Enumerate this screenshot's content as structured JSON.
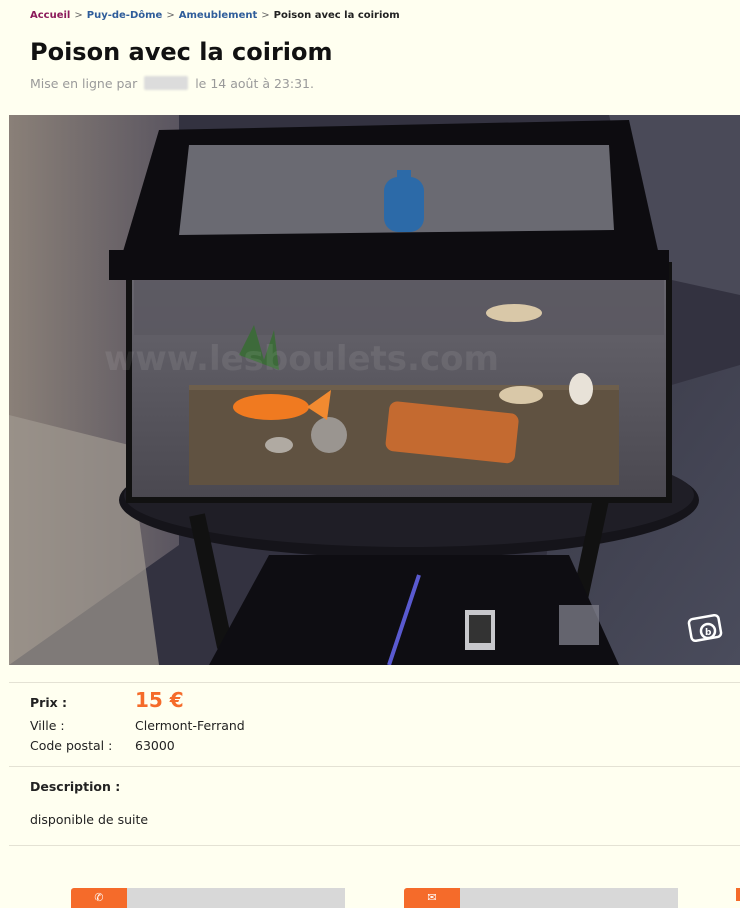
{
  "breadcrumb": {
    "home": "Accueil",
    "region": "Puy-de-Dôme",
    "category": "Ameublement",
    "current": "Poison avec la coiriom",
    "separator": ">"
  },
  "listing": {
    "title": "Poison avec la coiriom",
    "posted_prefix": "Mise en ligne par",
    "posted_suffix": "le 14 août à 23:31.",
    "photo_watermark": "www.lesboulets.com"
  },
  "details": {
    "price_label": "Prix :",
    "price_value": "15 €",
    "city_label": "Ville :",
    "city_value": "Clermont-Ferrand",
    "postal_label": "Code postal :",
    "postal_value": "63000",
    "description_label": "Description :",
    "description_text": "disponible de suite"
  },
  "actions": {
    "button1_icon": "phone-icon",
    "button2_icon": "mail-icon"
  },
  "colors": {
    "background": "#fffff0",
    "accent": "#f56b2a",
    "link": "#2f5d9a",
    "home_link": "#8b1a5a"
  }
}
